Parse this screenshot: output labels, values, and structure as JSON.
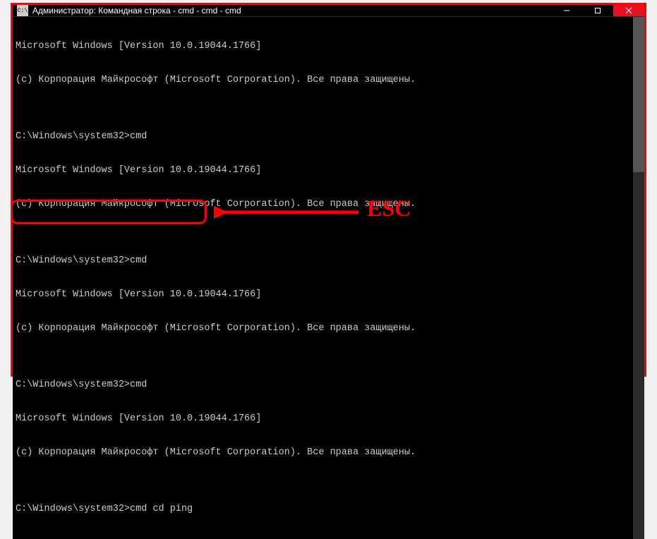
{
  "window": {
    "title": "Администратор: Командная строка - cmd - cmd - cmd",
    "icon_label": "C:\\"
  },
  "terminal": {
    "lines": [
      "Microsoft Windows [Version 10.0.19044.1766]",
      "(c) Корпорация Майкрософт (Microsoft Corporation). Все права защищены.",
      "",
      "C:\\Windows\\system32>cmd",
      "Microsoft Windows [Version 10.0.19044.1766]",
      "(c) Корпорация Майкрософт (Microsoft Corporation). Все права защищены.",
      "",
      "C:\\Windows\\system32>cmd",
      "Microsoft Windows [Version 10.0.19044.1766]",
      "(c) Корпорация Майкрософт (Microsoft Corporation). Все права защищены.",
      "",
      "C:\\Windows\\system32>cmd",
      "Microsoft Windows [Version 10.0.19044.1766]",
      "(c) Корпорация Майкрософт (Microsoft Corporation). Все права защищены.",
      "",
      "C:\\Windows\\system32>cmd cd ping"
    ]
  },
  "annotation": {
    "label": "ESC"
  }
}
